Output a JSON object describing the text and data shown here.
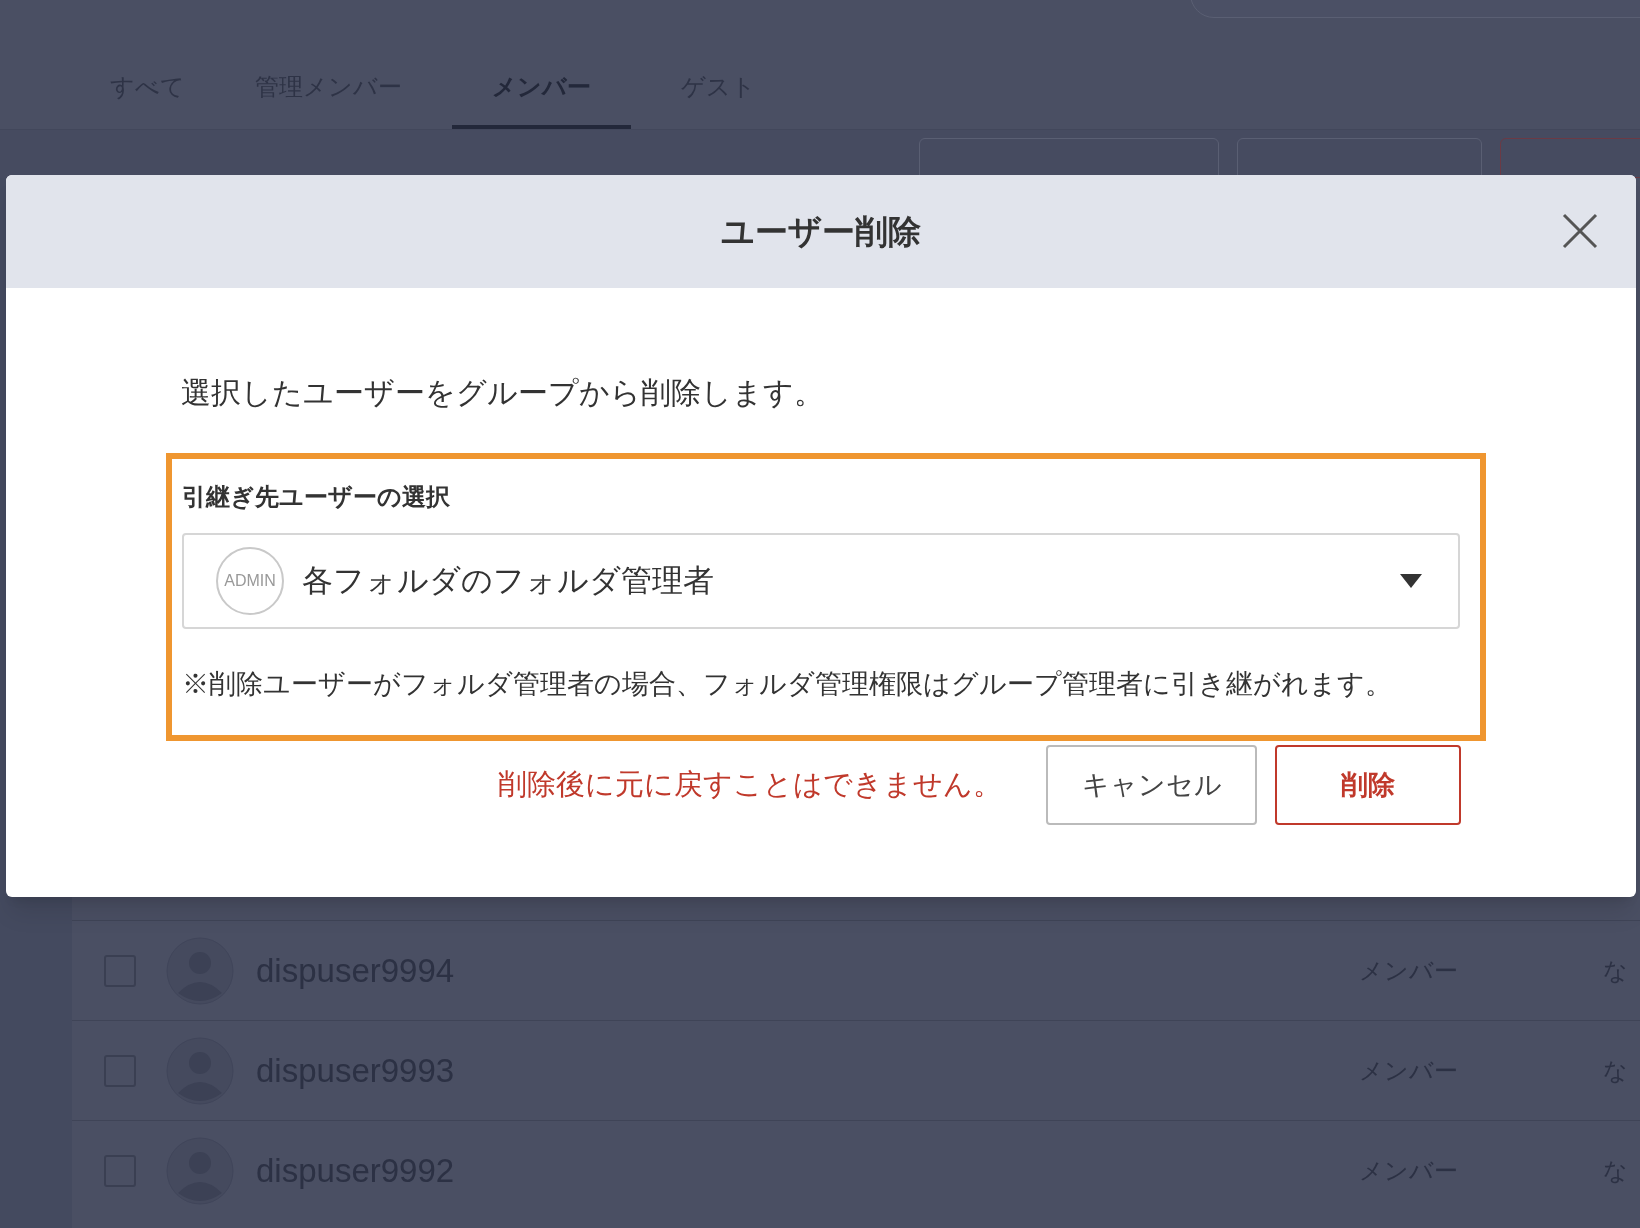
{
  "tabs": [
    {
      "label": "すべて",
      "selected": false
    },
    {
      "label": "管理メンバー",
      "selected": false
    },
    {
      "label": "メンバー",
      "selected": true
    },
    {
      "label": "ゲスト",
      "selected": false
    }
  ],
  "rows": [
    {
      "name": "dispuser9994",
      "role": "メンバー",
      "column_3": "な",
      "checked": false
    },
    {
      "name": "dispuser9993",
      "role": "メンバー",
      "column_3": "な",
      "checked": false
    },
    {
      "name": "dispuser9992",
      "role": "メンバー",
      "column_3": "な",
      "checked": false
    }
  ],
  "dialog": {
    "title": "ユーザー削除",
    "message": "選択したユーザーをグループから削除します。",
    "section_label": "引継ぎ先ユーザーの選択",
    "select": {
      "badge": "ADMIN",
      "value": "各フォルダのフォルダ管理者"
    },
    "note": "※削除ユーザーがフォルダ管理者の場合、フォルダ管理権限はグループ管理者に引き継がれます。",
    "warning": "削除後に元に戻すことはできません。",
    "buttons": [
      {
        "label": "キャンセル",
        "kind": "secondary"
      },
      {
        "label": "削除",
        "kind": "danger"
      }
    ]
  }
}
